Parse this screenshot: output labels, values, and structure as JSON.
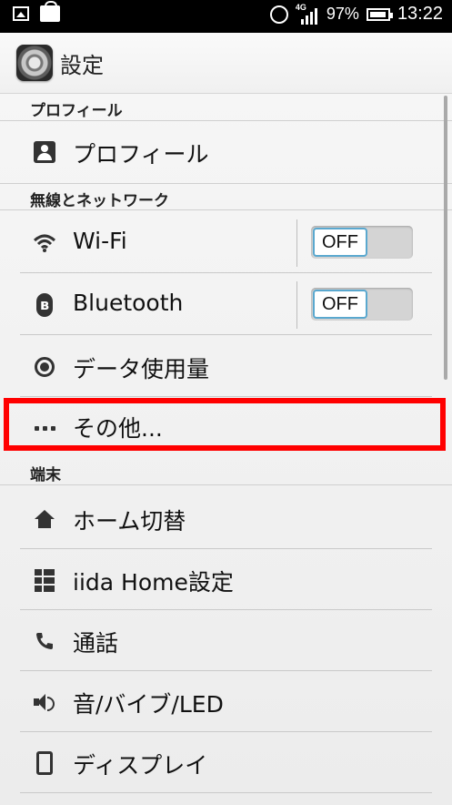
{
  "status_bar": {
    "network": "4G",
    "battery": "97%",
    "battery_level": 0.97,
    "time": "13:22",
    "icons": [
      "image-icon",
      "market-icon",
      "nfc-icon",
      "signal-icon",
      "battery-icon"
    ]
  },
  "action_bar": {
    "title": "設定",
    "icon": "settings-gear-icon"
  },
  "sections": [
    {
      "header": "プロフィール",
      "items": [
        {
          "label": "プロフィール",
          "icon": "profile-icon"
        }
      ]
    },
    {
      "header": "無線とネットワーク",
      "items": [
        {
          "label": "Wi-Fi",
          "icon": "wifi-icon",
          "toggle": "OFF"
        },
        {
          "label": "Bluetooth",
          "icon": "bluetooth-icon",
          "toggle": "OFF"
        },
        {
          "label": "データ使用量",
          "icon": "data-usage-icon"
        },
        {
          "label": "その他...",
          "icon": "more-icon",
          "highlighted": true
        }
      ]
    },
    {
      "header": "端末",
      "items": [
        {
          "label": "ホーム切替",
          "icon": "home-icon"
        },
        {
          "label": "iida Home設定",
          "icon": "grid-icon"
        },
        {
          "label": "通話",
          "icon": "phone-icon"
        },
        {
          "label": "音/バイブ/LED",
          "icon": "speaker-icon"
        },
        {
          "label": "ディスプレイ",
          "icon": "display-icon"
        }
      ]
    }
  ],
  "colors": {
    "highlight": "#ff0000",
    "toggle_border": "#5aa8cf"
  }
}
